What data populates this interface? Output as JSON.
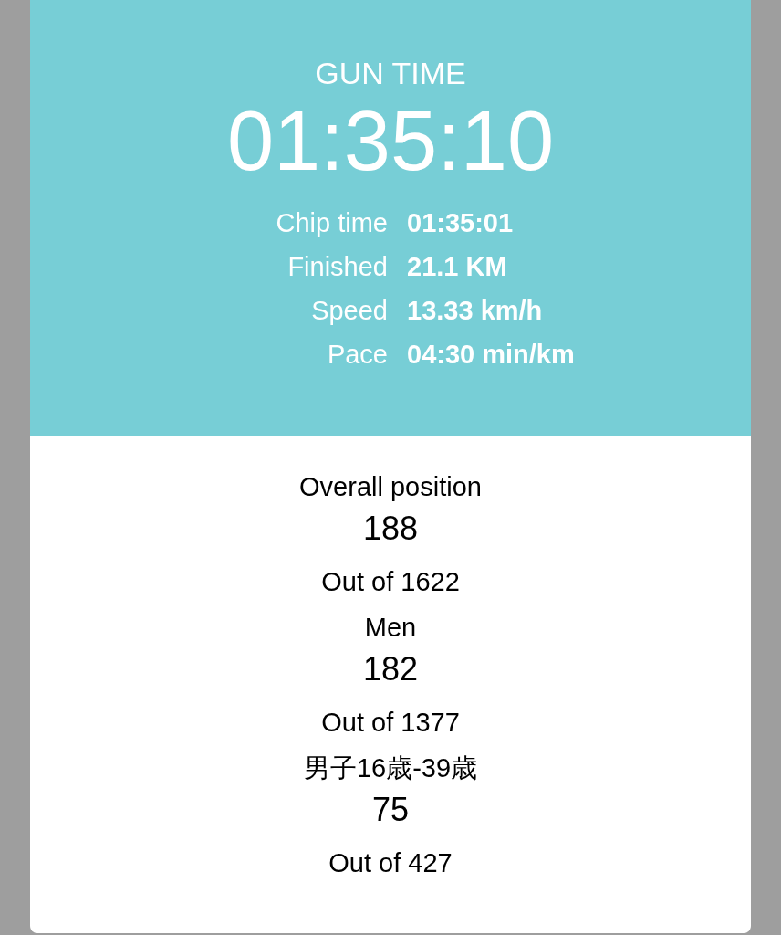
{
  "header": {
    "title": "GUN TIME",
    "time": "01:35:10"
  },
  "stats": [
    {
      "label": "Chip time",
      "value": "01:35:01"
    },
    {
      "label": "Finished",
      "value": "21.1 KM"
    },
    {
      "label": "Speed",
      "value": "13.33 km/h"
    },
    {
      "label": "Pace",
      "value": "04:30 min/km"
    }
  ],
  "positions": [
    {
      "label": "Overall position",
      "value": "188",
      "total": "Out of 1622"
    },
    {
      "label": "Men",
      "value": "182",
      "total": "Out of 1377"
    },
    {
      "label": "男子16歳-39歳",
      "value": "75",
      "total": "Out of 427"
    }
  ]
}
